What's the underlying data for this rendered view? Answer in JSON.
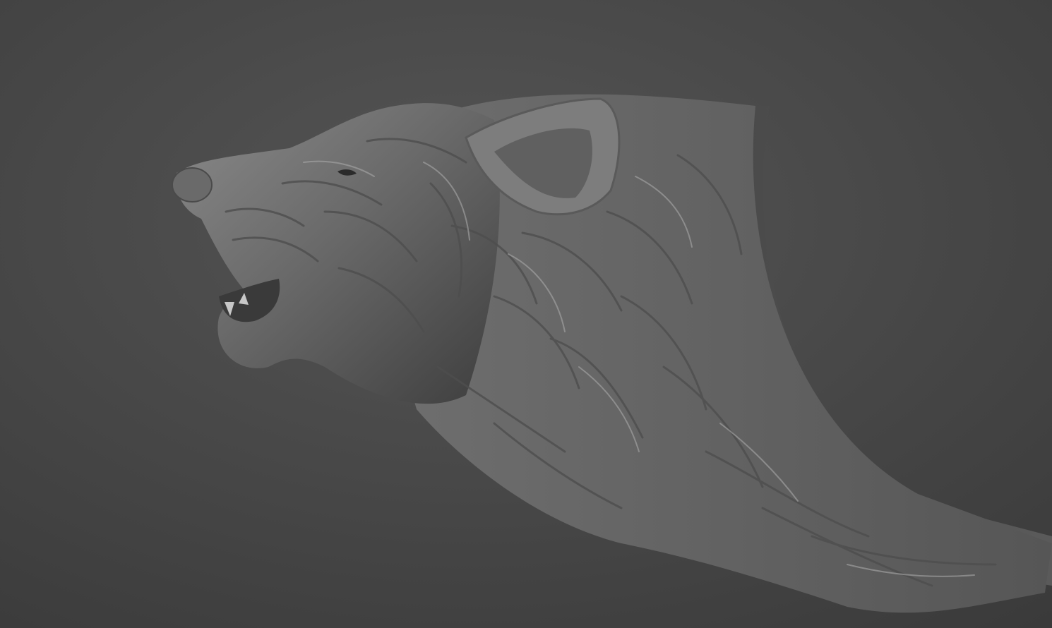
{
  "scene": {
    "subject": "wolf-head-relief-sculpt",
    "background_color": "#4b4b4b",
    "background_edge_color": "#3a3a3a",
    "material_highlight": "#bdbdbd",
    "material_mid": "#7a7a7a",
    "material_shadow": "#2f2f2f",
    "base_plate_color": "#545454"
  }
}
